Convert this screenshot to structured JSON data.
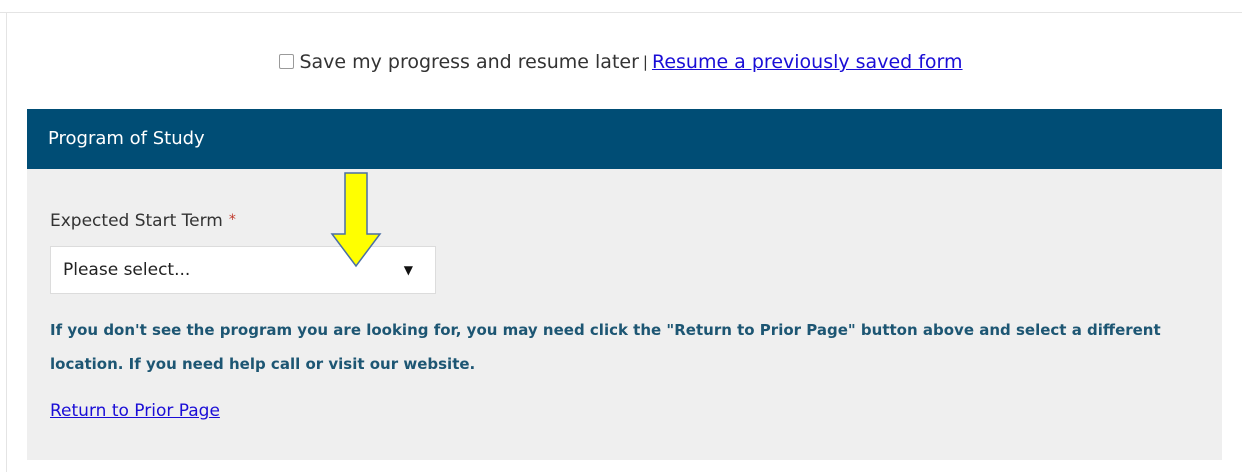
{
  "save_bar": {
    "checkbox_label": "Save my progress and resume later",
    "separator": "|",
    "resume_link": "Resume a previously saved form"
  },
  "section": {
    "title": "Program of Study"
  },
  "start_term": {
    "label": "Expected Start Term",
    "required_mark": "*",
    "selected_value": "Please select...",
    "caret": "▼"
  },
  "help": {
    "text": "If you don't see the program you are looking for, you may need click the \"Return to Prior Page\" button above and select a different location. If you need help call or visit our website."
  },
  "nav": {
    "return_link": "Return to Prior Page"
  },
  "colors": {
    "header_bg": "#004d75",
    "panel_bg": "#efefef",
    "link": "#1a0dd6",
    "help_text": "#1d5673",
    "arrow_fill": "#ffff00"
  }
}
